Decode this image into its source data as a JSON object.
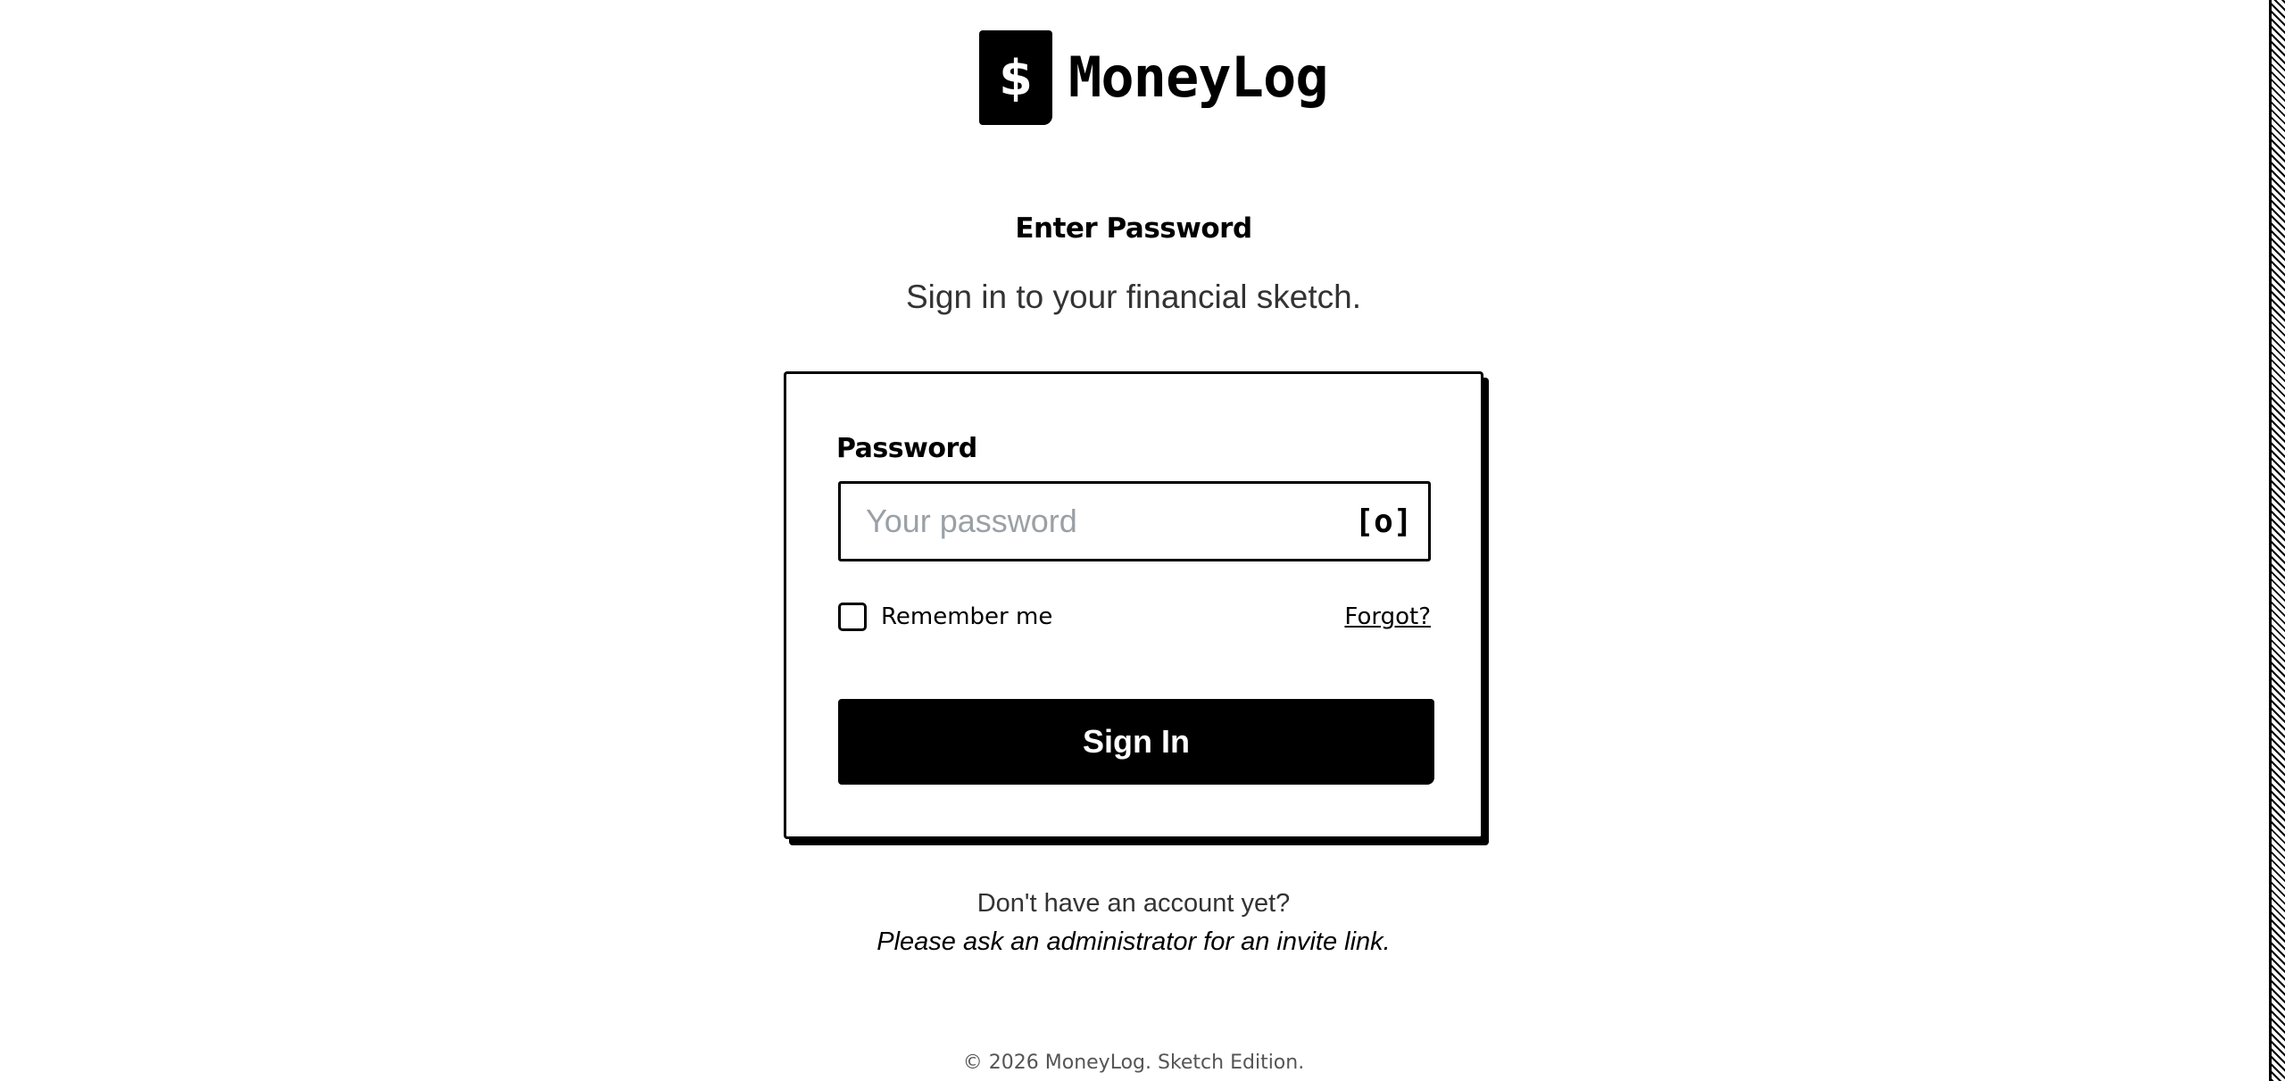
{
  "brand": {
    "logo_symbol": "$",
    "logo_icon": "dollar-icon",
    "name": "MoneyLog"
  },
  "heading": {
    "eyebrow": "Enter Password",
    "subtitle": "Sign in to your financial sketch."
  },
  "form": {
    "password_label": "Password",
    "password_placeholder": "Your password",
    "password_value": "",
    "toggle_visibility": "[o]",
    "toggle_icon": "eye-icon",
    "remember_label": "Remember me",
    "remember_checked": false,
    "forgot_label": "Forgot?",
    "submit_label": "Sign In"
  },
  "signup": {
    "question": "Don't have an account yet?",
    "note": "Please ask an administrator for an invite link."
  },
  "footer": {
    "copyright": "© 2026 MoneyLog. Sketch Edition."
  },
  "colors": {
    "ink": "#000000",
    "background": "#ffffff",
    "muted_text": "#333333",
    "placeholder": "#9aa0a6"
  }
}
